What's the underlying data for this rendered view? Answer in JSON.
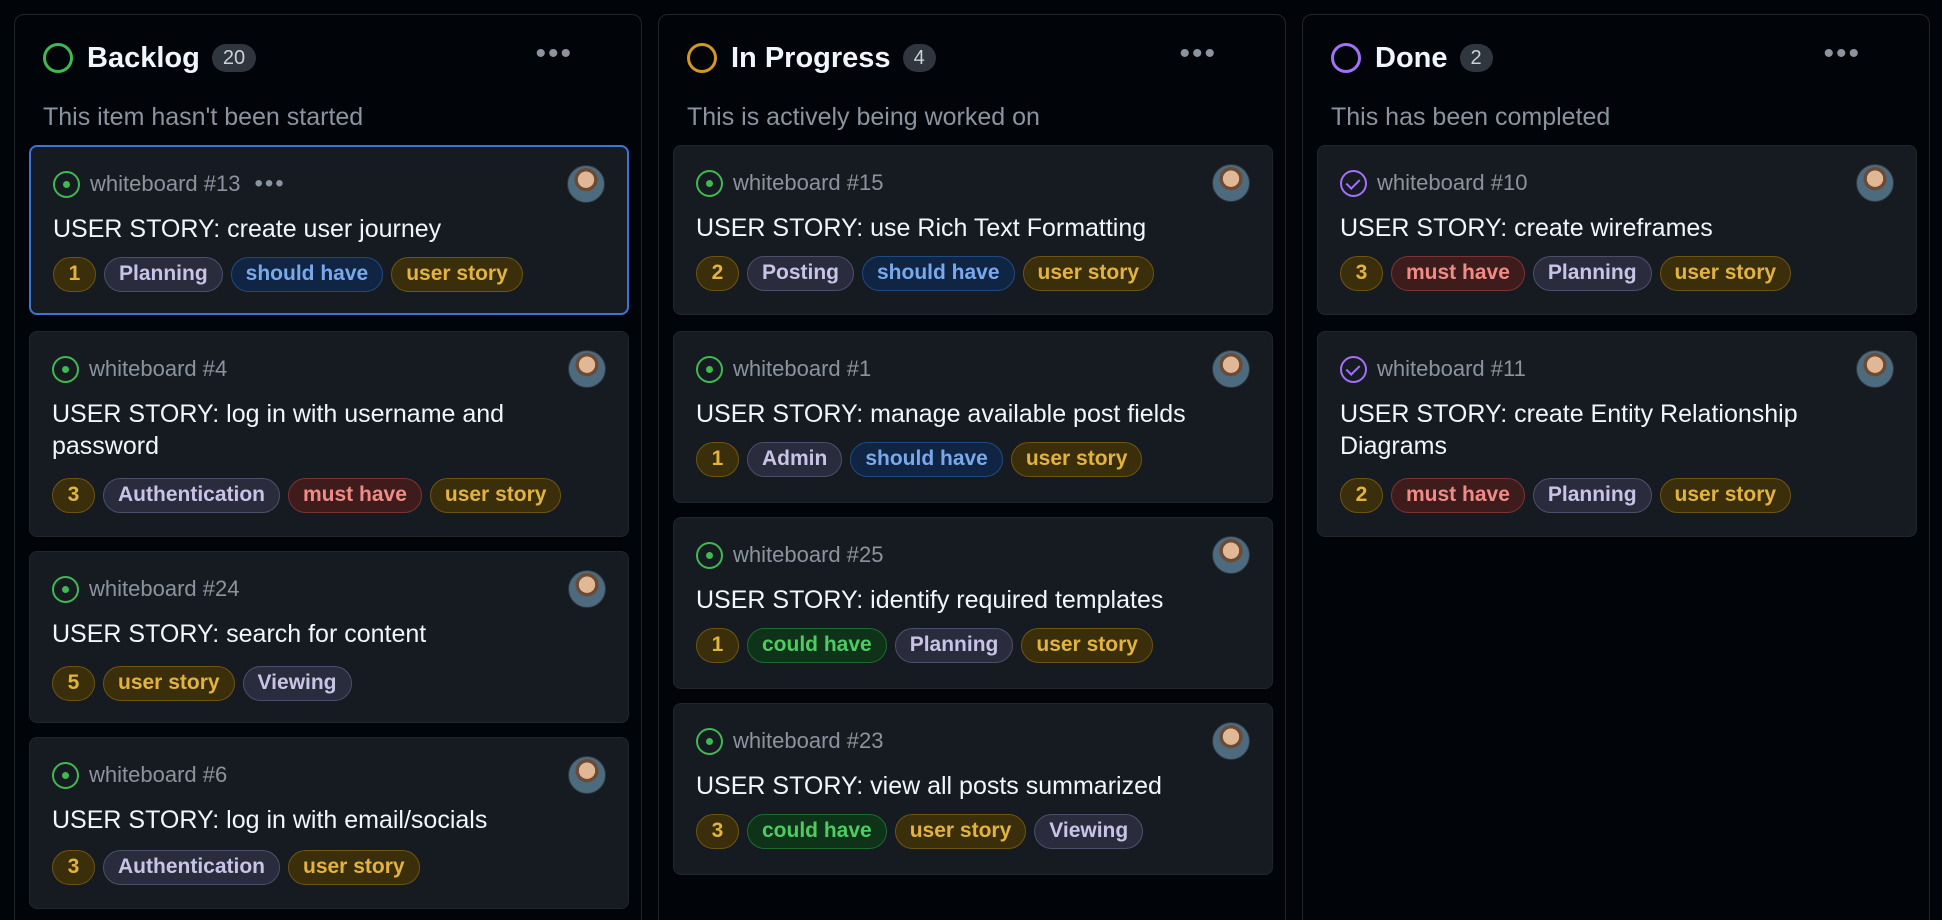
{
  "colors": {
    "backlog_ring": "#3fb950",
    "progress_ring": "#d29922",
    "done_ring": "#a371f7",
    "selected_border": "#3f73d8"
  },
  "columns": [
    {
      "title": "Backlog",
      "count": "20",
      "menu": "•••",
      "description": "This item hasn't been started",
      "cards": [
        {
          "ref": "whiteboard #13",
          "menu": "•••",
          "title": "USER STORY: create user journey",
          "points": "1",
          "labels": [
            "Planning",
            "should have",
            "user story"
          ],
          "selected": true
        },
        {
          "ref": "whiteboard #4",
          "title": "USER STORY: log in with username and password",
          "points": "3",
          "labels": [
            "Authentication",
            "must have",
            "user story"
          ]
        },
        {
          "ref": "whiteboard #24",
          "title": "USER STORY: search for content",
          "points": "5",
          "labels": [
            "user story",
            "Viewing"
          ]
        },
        {
          "ref": "whiteboard #6",
          "title": "USER STORY: log in with email/socials",
          "points": "3",
          "labels": [
            "Authentication",
            "user story"
          ]
        }
      ]
    },
    {
      "title": "In Progress",
      "count": "4",
      "menu": "•••",
      "description": "This is actively being worked on",
      "cards": [
        {
          "ref": "whiteboard #15",
          "title": "USER STORY: use Rich Text Formatting",
          "points": "2",
          "labels": [
            "Posting",
            "should have",
            "user story"
          ]
        },
        {
          "ref": "whiteboard #1",
          "title": "USER STORY: manage available post fields",
          "points": "1",
          "labels": [
            "Admin",
            "should have",
            "user story"
          ]
        },
        {
          "ref": "whiteboard #25",
          "title": "USER STORY: identify required templates",
          "points": "1",
          "labels": [
            "could have",
            "Planning",
            "user story"
          ]
        },
        {
          "ref": "whiteboard #23",
          "title": "USER STORY: view all posts summarized",
          "points": "3",
          "labels": [
            "could have",
            "user story",
            "Viewing"
          ]
        }
      ]
    },
    {
      "title": "Done",
      "count": "2",
      "menu": "•••",
      "description": "This has been completed",
      "cards": [
        {
          "ref": "whiteboard #10",
          "title": "USER STORY: create wireframes",
          "points": "3",
          "labels": [
            "must have",
            "Planning",
            "user story"
          ]
        },
        {
          "ref": "whiteboard #11",
          "title": "USER STORY: create Entity Relationship Diagrams",
          "points": "2",
          "labels": [
            "must have",
            "Planning",
            "user story"
          ]
        }
      ]
    }
  ]
}
